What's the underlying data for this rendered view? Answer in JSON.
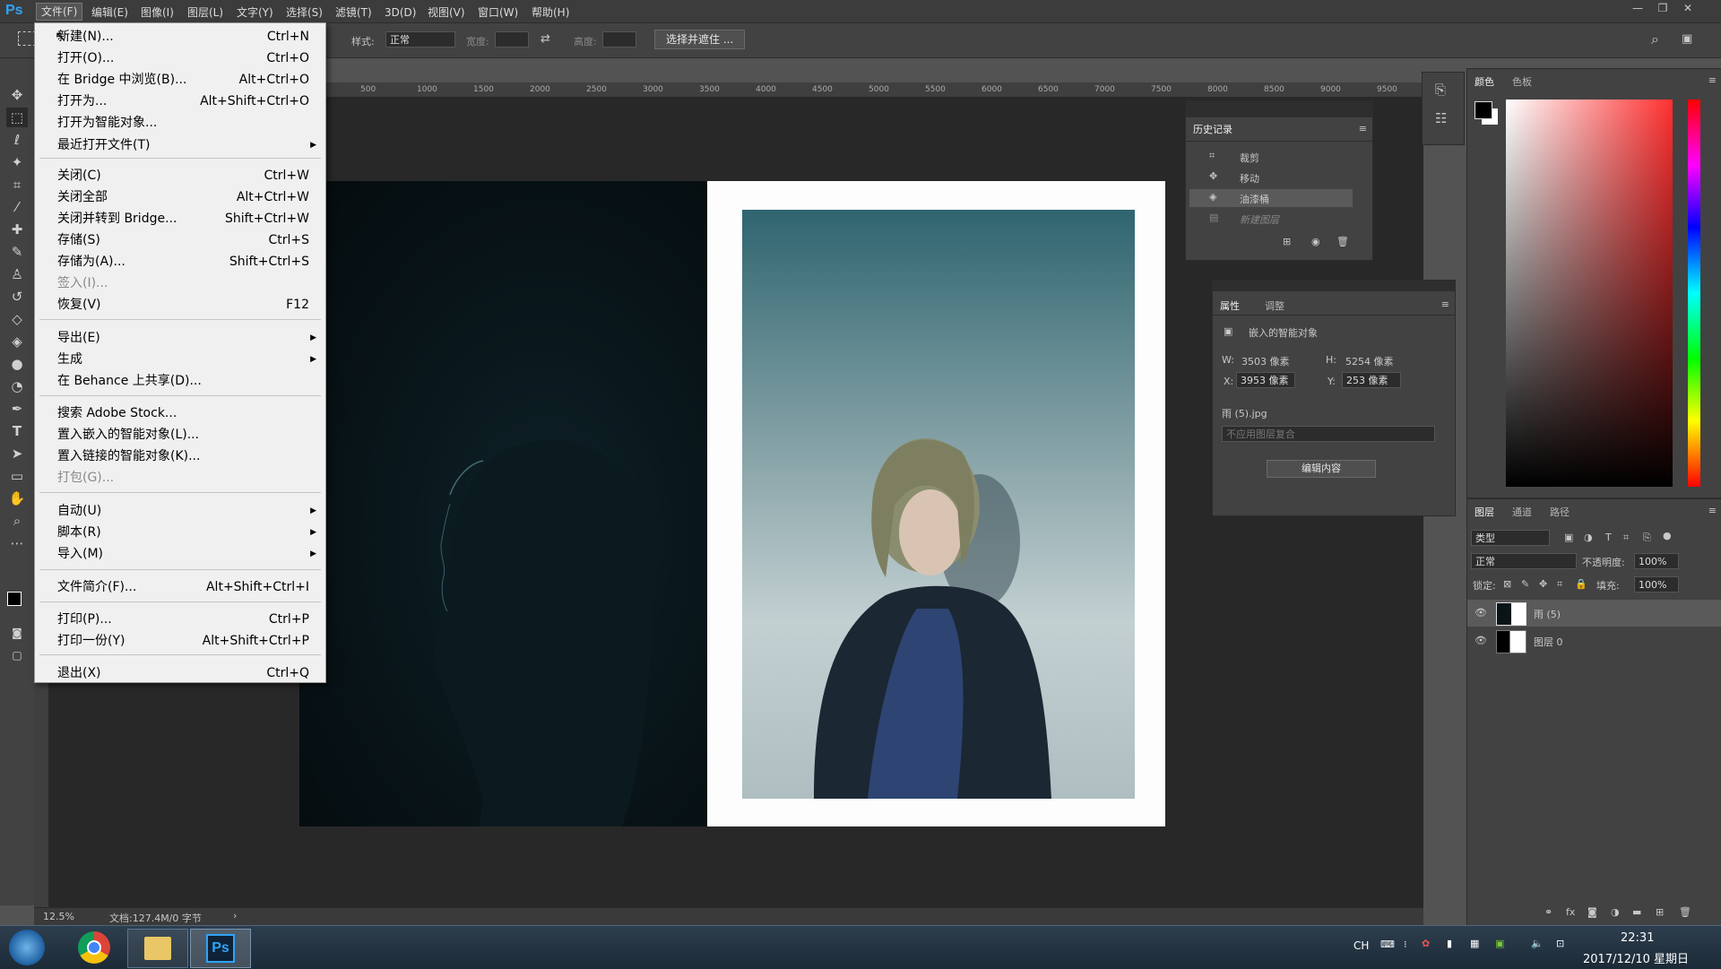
{
  "app": {
    "logo": "Ps"
  },
  "menubar": {
    "items": [
      "文件(F)",
      "编辑(E)",
      "图像(I)",
      "图层(L)",
      "文字(Y)",
      "选择(S)",
      "滤镜(T)",
      "3D(D)",
      "视图(V)",
      "窗口(W)",
      "帮助(H)"
    ]
  },
  "options": {
    "style_label": "样式:",
    "style_value": "正常",
    "width_label": "宽度:",
    "height_label": "高度:",
    "select_mask_button": "选择并遮住 ..."
  },
  "ruler": {
    "ticks": [
      "500",
      "1000",
      "1500",
      "2000",
      "2500",
      "3000",
      "3500",
      "4000",
      "4500",
      "5000",
      "5500",
      "6000",
      "6500",
      "7000",
      "7500",
      "8000",
      "8500",
      "9000",
      "9500"
    ]
  },
  "file_menu": {
    "items": [
      {
        "label": "新建(N)...",
        "shortcut": "Ctrl+N"
      },
      {
        "label": "打开(O)...",
        "shortcut": "Ctrl+O"
      },
      {
        "label": "在 Bridge 中浏览(B)...",
        "shortcut": "Alt+Ctrl+O"
      },
      {
        "label": "打开为...",
        "shortcut": "Alt+Shift+Ctrl+O"
      },
      {
        "label": "打开为智能对象...",
        "shortcut": ""
      },
      {
        "label": "最近打开文件(T)",
        "shortcut": ""
      },
      {
        "label": "关闭(C)",
        "shortcut": "Ctrl+W"
      },
      {
        "label": "关闭全部",
        "shortcut": "Alt+Ctrl+W"
      },
      {
        "label": "关闭并转到 Bridge...",
        "shortcut": "Shift+Ctrl+W"
      },
      {
        "label": "存储(S)",
        "shortcut": "Ctrl+S"
      },
      {
        "label": "存储为(A)...",
        "shortcut": "Shift+Ctrl+S"
      },
      {
        "label": "签入(I)...",
        "shortcut": ""
      },
      {
        "label": "恢复(V)",
        "shortcut": "F12"
      },
      {
        "label": "导出(E)",
        "shortcut": ""
      },
      {
        "label": "生成",
        "shortcut": ""
      },
      {
        "label": "在 Behance 上共享(D)...",
        "shortcut": ""
      },
      {
        "label": "搜索 Adobe Stock...",
        "shortcut": ""
      },
      {
        "label": "置入嵌入的智能对象(L)...",
        "shortcut": ""
      },
      {
        "label": "置入链接的智能对象(K)...",
        "shortcut": ""
      },
      {
        "label": "打包(G)...",
        "shortcut": ""
      },
      {
        "label": "自动(U)",
        "shortcut": ""
      },
      {
        "label": "脚本(R)",
        "shortcut": ""
      },
      {
        "label": "导入(M)",
        "shortcut": ""
      },
      {
        "label": "文件简介(F)...",
        "shortcut": "Alt+Shift+Ctrl+I"
      },
      {
        "label": "打印(P)...",
        "shortcut": "Ctrl+P"
      },
      {
        "label": "打印一份(Y)",
        "shortcut": "Alt+Shift+Ctrl+P"
      },
      {
        "label": "退出(X)",
        "shortcut": "Ctrl+Q"
      }
    ]
  },
  "history": {
    "title": "历史记录",
    "items": [
      "裁剪",
      "移动",
      "油漆桶",
      "新建图层"
    ]
  },
  "properties": {
    "tabs": [
      "属性",
      "调整"
    ],
    "type": "嵌入的智能对象",
    "w_label": "W:",
    "w_value": "3503 像素",
    "h_label": "H:",
    "h_value": "5254 像素",
    "x_label": "X:",
    "x_value": "3953 像素",
    "y_label": "Y:",
    "y_value": "253 像素",
    "filename": "雨 (5).jpg",
    "comp": "不应用图层复合",
    "edit_button": "编辑内容"
  },
  "color": {
    "tabs": [
      "颜色",
      "色板"
    ]
  },
  "layers": {
    "tabs": [
      "图层",
      "通道",
      "路径"
    ],
    "filter": "类型",
    "blend": "正常",
    "opacity_label": "不透明度:",
    "opacity": "100%",
    "lock_label": "锁定:",
    "fill_label": "填充:",
    "fill": "100%",
    "items": [
      "雨 (5)",
      "图层 0"
    ]
  },
  "status": {
    "zoom": "12.5%",
    "doc": "文档:127.4M/0 字节"
  },
  "taskbar": {
    "lang": "CH",
    "time": "22:31",
    "date": "2017/12/10 星期日"
  }
}
